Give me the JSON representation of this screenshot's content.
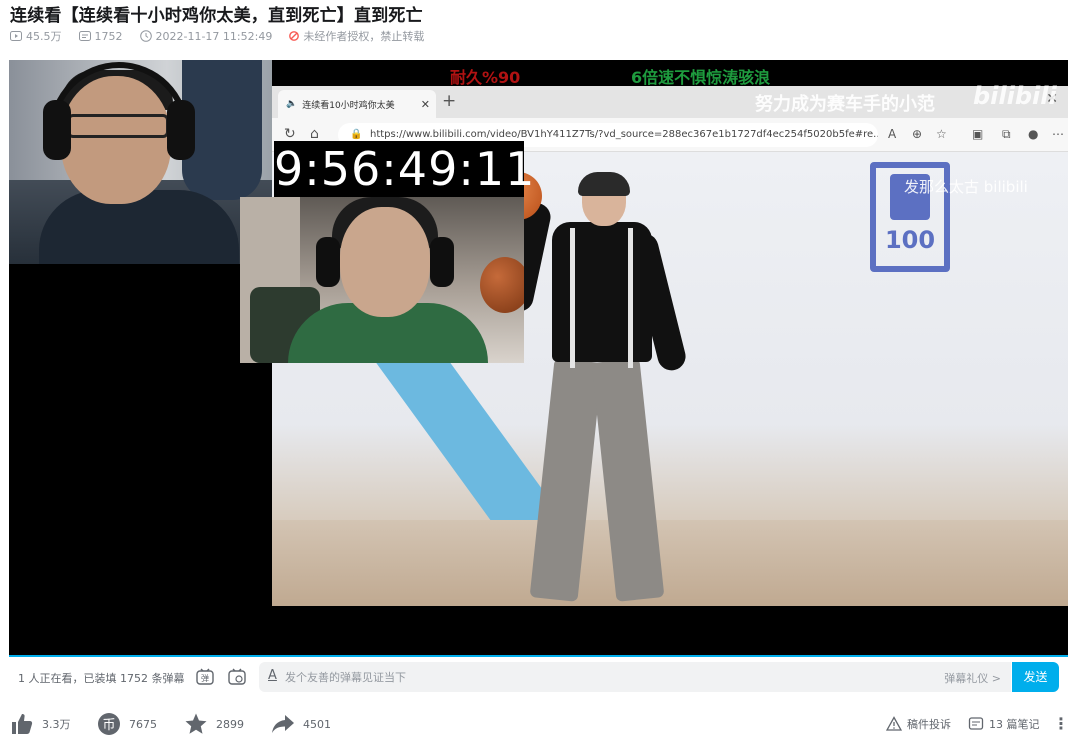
{
  "video": {
    "title": "连续看【连续看十小时鸡你太美，直到死亡】直到死亡",
    "views": "45.5万",
    "danmaku_count": "1752",
    "pubdate": "2022-11-17 11:52:49",
    "copyright_notice": "未经作者授权，禁止转载"
  },
  "player": {
    "overlay_red": "耐久%90",
    "overlay_green": "6倍速不惧惊涛骇浪",
    "overlay_white": "努力成为赛车手的小范",
    "watermark_logo": "bilibili",
    "timer": "9:56:49:11",
    "browser": {
      "tab_title": "连续看10小时鸡你太美",
      "url": "https://www.bilibili.com/video/BV1hY411Z7Ts/?vd_source=288ec367e1b1727df4ec254f5020b5fe#re...",
      "inner_watermark": "发那么太古 bilibili",
      "inner_logo_text": "100"
    }
  },
  "danmaku_bar": {
    "watching_text": "1 人正在看，已装填 1752 条弹幕",
    "input_placeholder": "发个友善的弹幕见证当下",
    "etiquette": "弹幕礼仪 >",
    "send": "发送"
  },
  "toolbar": {
    "like": "3.3万",
    "coin": "7675",
    "favorite": "2899",
    "share": "4501",
    "report": "稿件投诉",
    "notes": "13 篇笔记"
  },
  "colors": {
    "accent": "#00aeec",
    "text": "#18191c",
    "muted": "#9499a0",
    "warn": "#f85a54"
  }
}
